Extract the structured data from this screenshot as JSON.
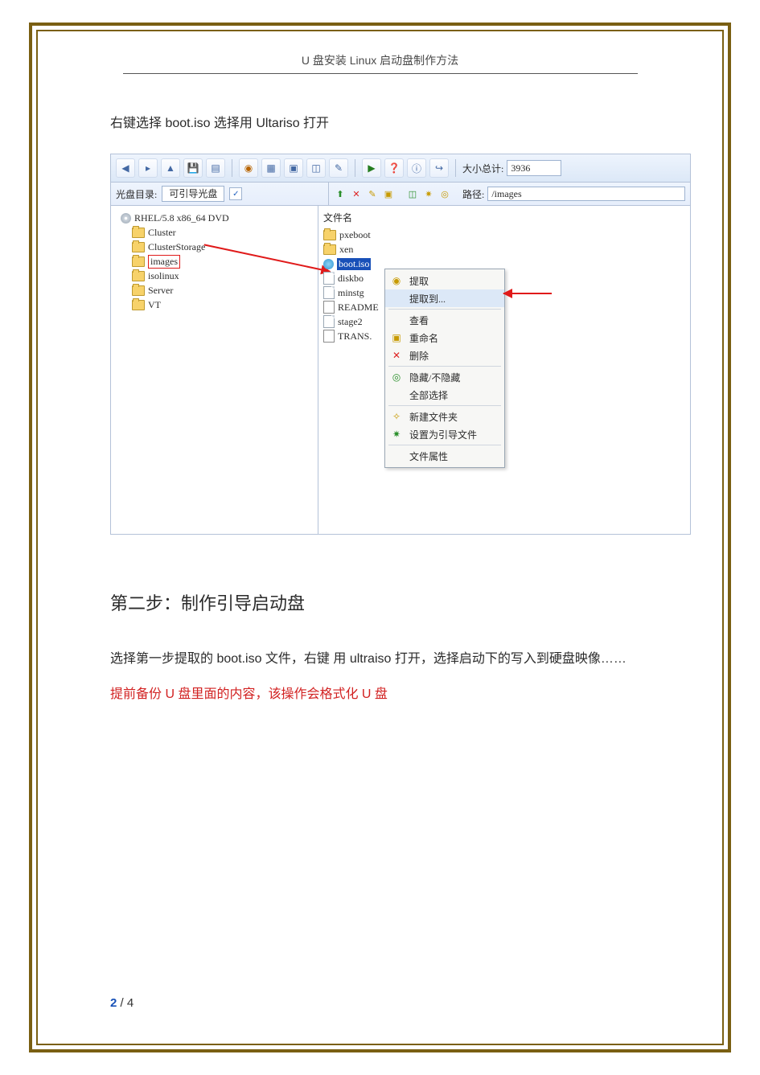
{
  "header": {
    "title": "U 盘安装 Linux   启动盘制作方法"
  },
  "intro": {
    "text": "右键选择 boot.iso 选择用 Ultariso 打开"
  },
  "screenshot": {
    "toolbar": {
      "size_total_label": "大小总计:",
      "size_total_value": "3936"
    },
    "row2_left": {
      "label": "光盘目录:",
      "bookable": "可引导光盘"
    },
    "row2_right": {
      "path_label": "路径:",
      "path_value": "/images"
    },
    "tree": {
      "root": "RHEL/5.8 x86_64 DVD",
      "items": [
        "Cluster",
        "ClusterStorage",
        "images",
        "isolinux",
        "Server",
        "VT"
      ],
      "highlight": "images"
    },
    "files": {
      "header": "文件名",
      "items": [
        "pxeboot",
        "xen",
        "boot.iso",
        "diskbo",
        "minstg",
        "README",
        "stage2",
        "TRANS."
      ],
      "selected": "boot.iso"
    },
    "context_menu": {
      "items": [
        {
          "label": "提取",
          "icon": "extract-icon"
        },
        {
          "label": "提取到...",
          "icon": "extract-to-icon",
          "hl": true
        },
        {
          "label": "查看",
          "icon": "view-icon"
        },
        {
          "label": "重命名",
          "icon": "rename-icon"
        },
        {
          "label": "删除",
          "icon": "delete-icon"
        },
        {
          "label": "隐藏/不隐藏",
          "icon": "hide-icon"
        },
        {
          "label": "全部选择",
          "icon": "select-all-icon"
        },
        {
          "label": "新建文件夹",
          "icon": "new-folder-icon"
        },
        {
          "label": "设置为引导文件",
          "icon": "set-boot-icon"
        },
        {
          "label": "文件属性",
          "icon": "properties-icon"
        }
      ]
    }
  },
  "section2": {
    "heading": "第二步：制作引导启动盘",
    "body": "选择第一步提取的 boot.iso 文件，右键  用 ultraiso 打开，选择启动下的写入到硬盘映像……",
    "warning": "提前备份 U 盘里面的内容，该操作会格式化 U 盘"
  },
  "footer": {
    "page_current": "2",
    "page_sep": " / ",
    "page_total": "4"
  }
}
